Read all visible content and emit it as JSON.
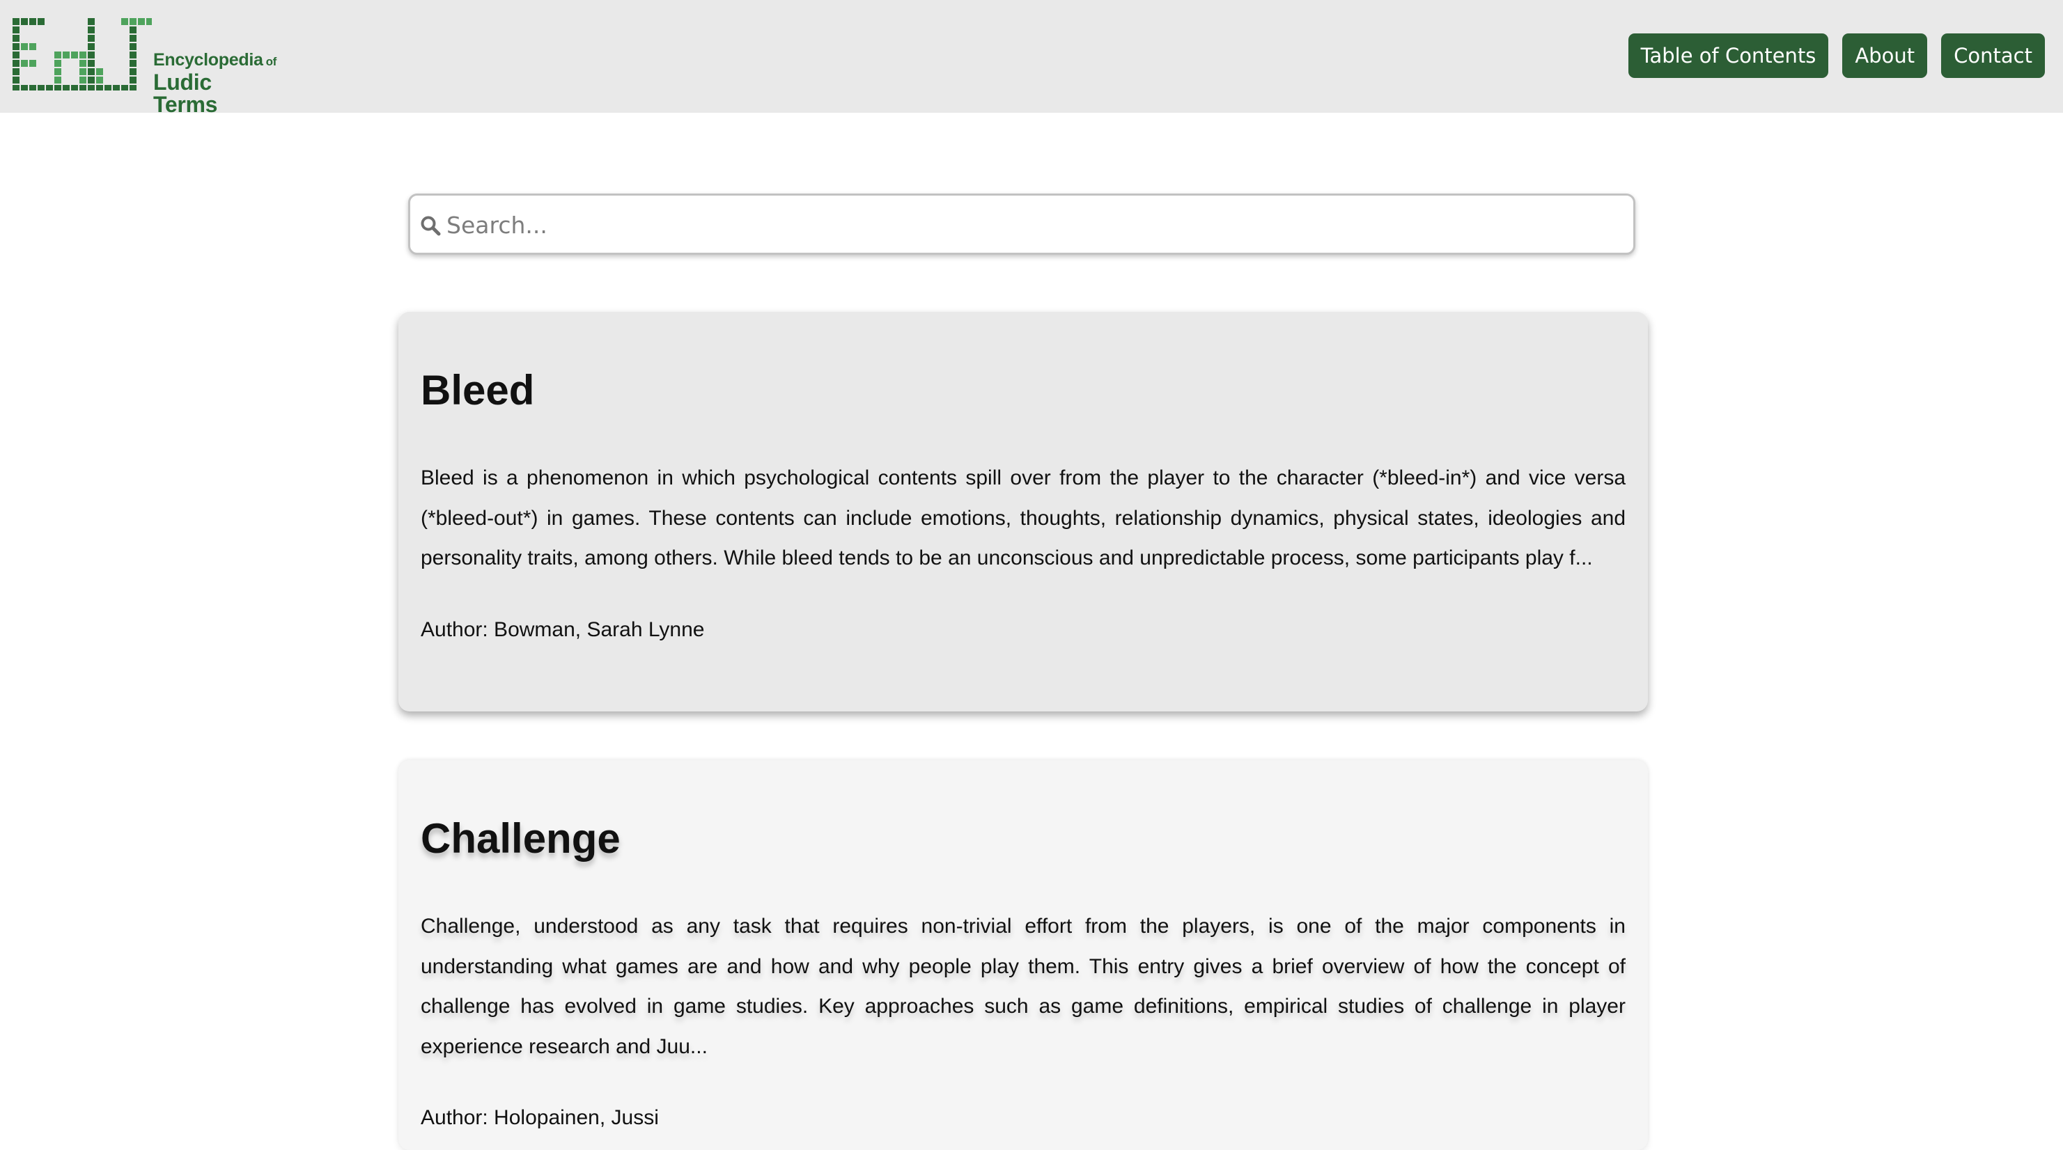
{
  "logo": {
    "line1": "Encyclopedia",
    "of": "of",
    "line2": "Ludic Terms",
    "color": "#2a6b35",
    "accent_light": "#4ea35c"
  },
  "nav": {
    "items": [
      {
        "label": "Table of Contents"
      },
      {
        "label": "About"
      },
      {
        "label": "Contact"
      }
    ],
    "button_color": "#2c5e35"
  },
  "search": {
    "placeholder": "Search...",
    "value": "",
    "icon": "search-icon"
  },
  "entries": [
    {
      "title": "Bleed",
      "excerpt": "Bleed is a phenomenon in which psychological contents spill over from the player to the character (*bleed-in*) and vice versa (*bleed-out*) in games. These contents can include emotions, thoughts, relationship dynamics, physical states, ideologies and personality traits, among others. While bleed tends to be an unconscious and unpredictable process, some participants play f...",
      "author": "Author: Bowman, Sarah Lynne"
    },
    {
      "title": "Challenge",
      "excerpt": "Challenge, understood as any task that requires non-trivial effort from the players, is one of the major components in understanding what games are and how and why people play them. This entry gives a brief overview of how the concept of challenge has evolved in game studies. Key approaches such as game definitions, empirical studies of challenge in player experience research and Juu...",
      "author": "Author: Holopainen, Jussi"
    }
  ],
  "colors": {
    "header_bg": "#e9e9e9",
    "card_active_bg": "#e9e9e9",
    "card_bg": "#f5f5f5"
  }
}
